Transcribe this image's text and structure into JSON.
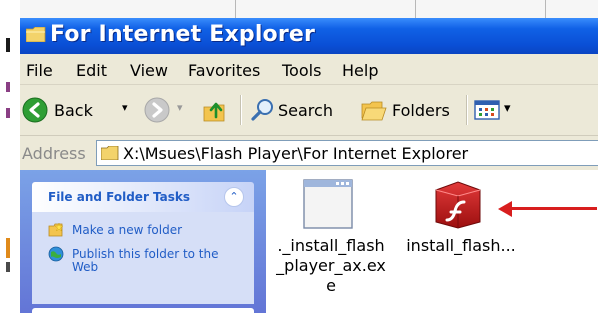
{
  "window": {
    "title": "For Internet Explorer"
  },
  "menu": {
    "items": [
      "File",
      "Edit",
      "View",
      "Favorites",
      "Tools",
      "Help"
    ]
  },
  "toolbar": {
    "back_label": "Back",
    "search_label": "Search",
    "folders_label": "Folders"
  },
  "address": {
    "label": "Address",
    "value": "X:\\Msues\\Flash Player\\For Internet Explorer"
  },
  "tasks": {
    "header": "File and Folder Tasks",
    "collapse_glyph": "⌃",
    "links": [
      "Make a new folder",
      "Publish this folder to the\nWeb"
    ]
  },
  "files": [
    {
      "name": "._install_flash\n_player_ax.ex\ne",
      "icon": "application-window-icon"
    },
    {
      "name": "install_flash...",
      "icon": "flash-installer-icon"
    }
  ],
  "colors": {
    "titlebar": "#0a4fd6",
    "taskpane": "#7ba2e7",
    "link": "#215dc6",
    "arrow": "#d81e1e",
    "flash_red": "#c41b1b"
  }
}
